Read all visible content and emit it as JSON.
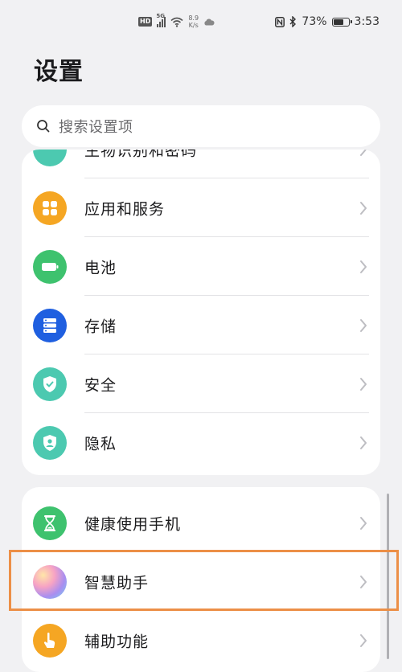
{
  "status_bar": {
    "hd": "HD",
    "network": "5G",
    "speed_value": "8.9",
    "speed_unit": "K/s",
    "battery": "73%",
    "battery_level": 0.73,
    "time": "3:53"
  },
  "page": {
    "title": "设置"
  },
  "search": {
    "placeholder": "搜索设置项"
  },
  "settings_group_1": [
    {
      "label": "生物识别和密码",
      "icon": "fingerprint-icon",
      "color": "#4cc9b0"
    },
    {
      "label": "应用和服务",
      "icon": "apps-icon",
      "color": "#f5a623"
    },
    {
      "label": "电池",
      "icon": "battery-icon",
      "color": "#3ec26e"
    },
    {
      "label": "存储",
      "icon": "storage-icon",
      "color": "#1f5fe0"
    },
    {
      "label": "安全",
      "icon": "shield-check-icon",
      "color": "#4cc9b0"
    },
    {
      "label": "隐私",
      "icon": "privacy-icon",
      "color": "#4cc9b0"
    }
  ],
  "settings_group_2": [
    {
      "label": "健康使用手机",
      "icon": "hourglass-icon",
      "color": "#3ec26e"
    },
    {
      "label": "智慧助手",
      "icon": "assistant-icon",
      "color": "#b88ae8"
    },
    {
      "label": "辅助功能",
      "icon": "hand-icon",
      "color": "#f5a623"
    }
  ],
  "highlight_color": "#ec8f47"
}
